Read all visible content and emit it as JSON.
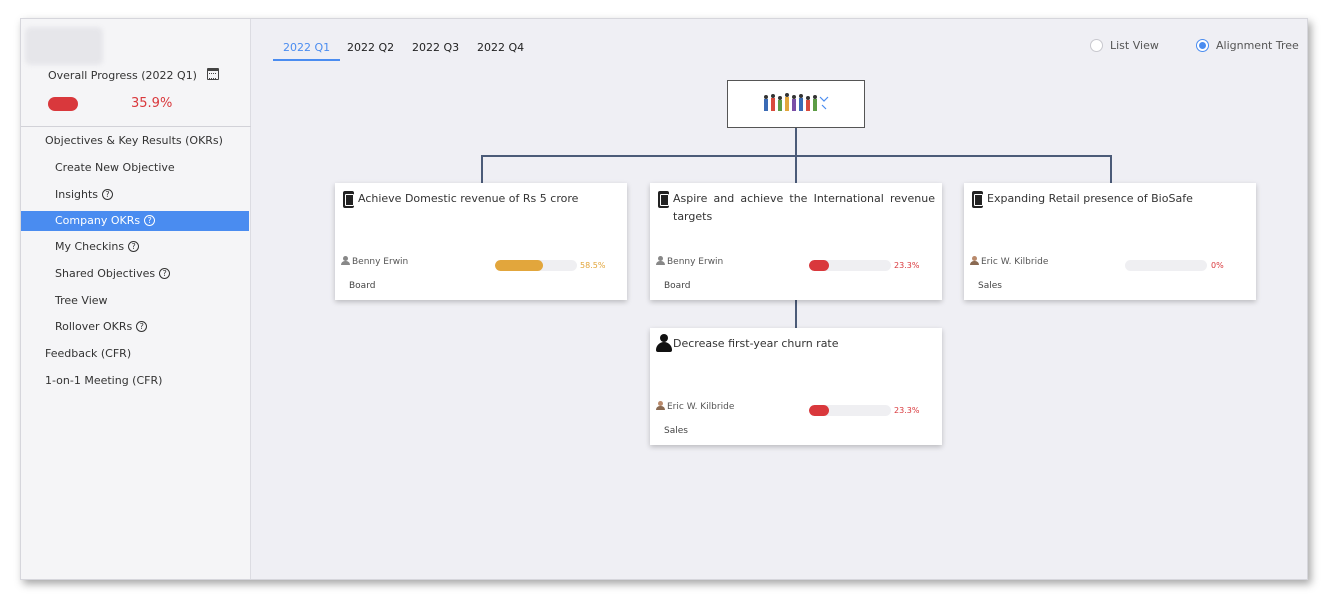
{
  "sidebar": {
    "overall_label": "Overall Progress (2022 Q1)",
    "overall_pct": "35.9%",
    "overall_color": "#d9383c",
    "items": [
      {
        "label": "Objectives & Key Results (OKRs)",
        "level": "top",
        "help": false,
        "active": false
      },
      {
        "label": "Create New Objective",
        "level": "sub",
        "help": false,
        "active": false
      },
      {
        "label": "Insights",
        "level": "sub",
        "help": true,
        "active": false
      },
      {
        "label": "Company OKRs",
        "level": "sub",
        "help": true,
        "active": true
      },
      {
        "label": "My Checkins",
        "level": "sub",
        "help": true,
        "active": false
      },
      {
        "label": "Shared Objectives",
        "level": "sub",
        "help": true,
        "active": false
      },
      {
        "label": "Tree View",
        "level": "sub",
        "help": false,
        "active": false
      },
      {
        "label": "Rollover OKRs",
        "level": "sub",
        "help": true,
        "active": false
      },
      {
        "label": "Feedback (CFR)",
        "level": "top",
        "help": false,
        "active": false
      },
      {
        "label": "1-on-1 Meeting (CFR)",
        "level": "top",
        "help": false,
        "active": false
      }
    ]
  },
  "tabs": [
    "2022 Q1",
    "2022 Q2",
    "2022 Q3",
    "2022 Q4"
  ],
  "active_tab": 0,
  "view_options": {
    "list_view": "List View",
    "alignment_tree": "Alignment Tree",
    "selected": "alignment_tree"
  },
  "accent_color": "#4a8cf0",
  "cards": [
    {
      "title": "Achieve Domestic revenue of Rs 5 crore",
      "owner": "Benny Erwin",
      "dept": "Board",
      "progress": 58.5,
      "pct": "58.5%",
      "color": "#e2a63c",
      "icon": "okr-document-icon",
      "justify": false
    },
    {
      "title": "Aspire and achieve the International revenue targets",
      "owner": "Benny Erwin",
      "dept": "Board",
      "progress": 23.3,
      "pct": "23.3%",
      "color": "#d9383c",
      "icon": "okr-document-icon",
      "justify": true
    },
    {
      "title": "Expanding Retail presence of BioSafe",
      "owner": "Eric W. Kilbride",
      "dept": "Sales",
      "progress": 0,
      "pct": "0%",
      "color": "#d9383c",
      "icon": "okr-document-icon",
      "justify": false
    },
    {
      "title": "Decrease first-year churn rate",
      "owner": "Eric W. Kilbride",
      "dept": "Sales",
      "progress": 23.3,
      "pct": "23.3%",
      "color": "#d9383c",
      "icon": "person-icon",
      "justify": false
    }
  ]
}
